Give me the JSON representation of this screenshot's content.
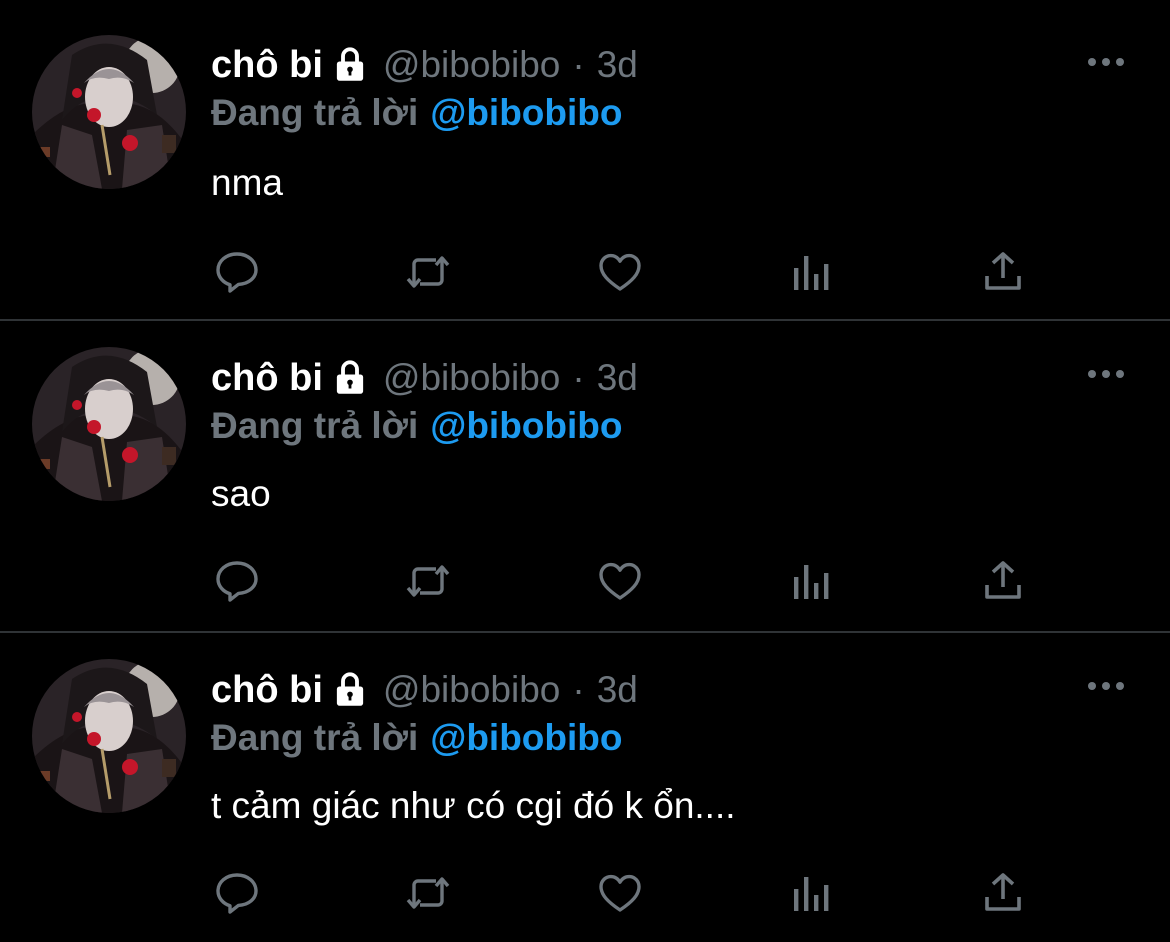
{
  "colors": {
    "background": "#000000",
    "primary_text": "#ffffff",
    "secondary_text": "#6e767d",
    "accent": "#1d9bf0",
    "divider": "#2f3336"
  },
  "tweets": [
    {
      "display_name": "chô bi",
      "handle": "@bibobibo",
      "separator": "·",
      "time": "3d",
      "replying_label": "Đang trả lời",
      "replying_to": "@bibobibo",
      "text": "nma",
      "icons": [
        "lock-icon",
        "more-icon",
        "reply-icon",
        "retweet-icon",
        "like-icon",
        "analytics-icon",
        "share-icon"
      ]
    },
    {
      "display_name": "chô bi",
      "handle": "@bibobibo",
      "separator": "·",
      "time": "3d",
      "replying_label": "Đang trả lời",
      "replying_to": "@bibobibo",
      "text": "sao",
      "icons": [
        "lock-icon",
        "more-icon",
        "reply-icon",
        "retweet-icon",
        "like-icon",
        "analytics-icon",
        "share-icon"
      ]
    },
    {
      "display_name": "chô bi",
      "handle": "@bibobibo",
      "separator": "·",
      "time": "3d",
      "replying_label": "Đang trả lời",
      "replying_to": "@bibobibo",
      "text": "t cảm giác như có cgi đó k ổn....",
      "icons": [
        "lock-icon",
        "more-icon",
        "reply-icon",
        "retweet-icon",
        "like-icon",
        "analytics-icon",
        "share-icon"
      ]
    }
  ]
}
